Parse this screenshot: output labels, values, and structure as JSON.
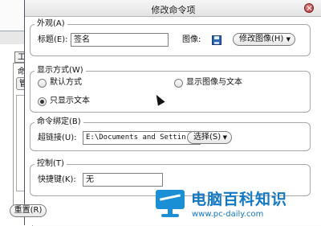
{
  "background_window": {
    "tab_label": "工",
    "pane_label": "命",
    "button_label": "管"
  },
  "dialog": {
    "title": "修改命令项",
    "appearance": {
      "legend": "外观(A)",
      "title_label": "标题(E):",
      "title_value": "签名",
      "image_label": "图像:",
      "modify_image_button": "修改图像(H)"
    },
    "display": {
      "legend": "显示方式(W)",
      "options": [
        {
          "label": "默认方式",
          "selected": false
        },
        {
          "label": "显示图像与文本",
          "selected": false
        },
        {
          "label": "只显示文本",
          "selected": true
        }
      ]
    },
    "binding": {
      "legend": "命令绑定(B)",
      "hyperlink_label": "超链接(U):",
      "hyperlink_value": "E:\\Documents and Settin",
      "select_button": "选择(S)"
    },
    "control": {
      "legend": "控制(T)",
      "shortcut_label": "快捷键(K):",
      "shortcut_value": "无"
    },
    "reset_button": "重置(R)"
  },
  "watermark": {
    "name": "电脑百科知识",
    "url": "www.pc-daily.com"
  },
  "colors": {
    "accent": "#1378c4",
    "close": "#b93434",
    "floppy": "#2b66b8"
  }
}
